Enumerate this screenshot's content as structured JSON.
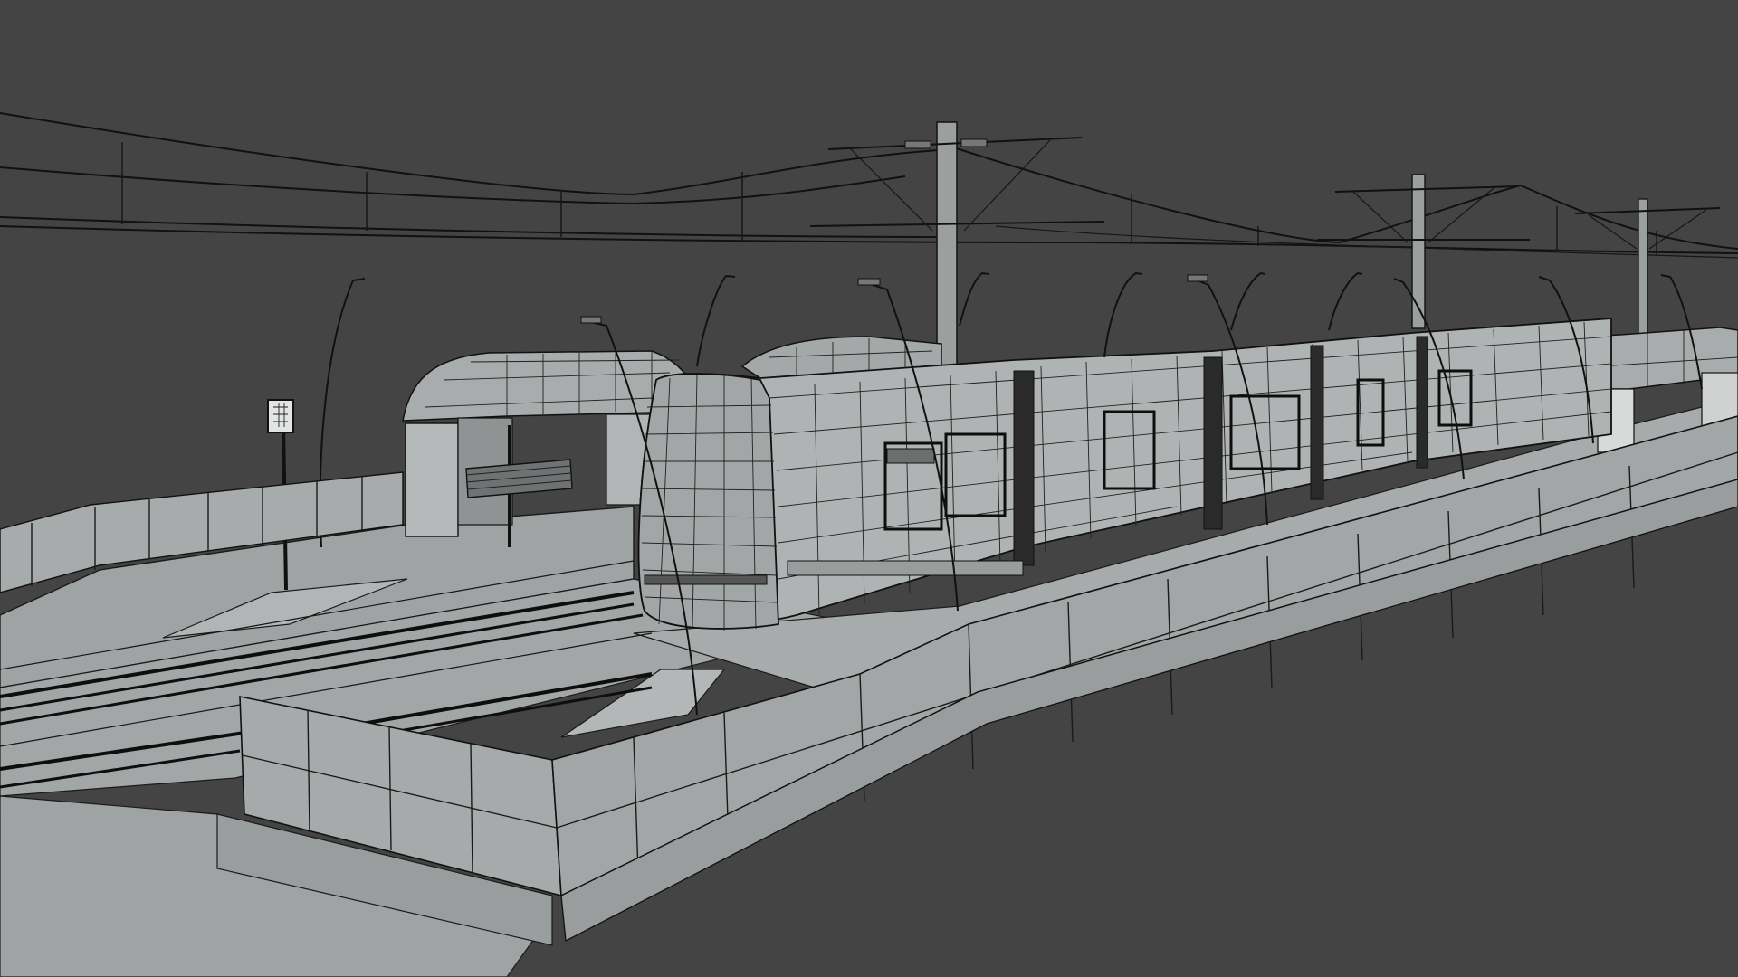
{
  "viewport": {
    "background_color": "#444444",
    "shading": "wireframe-on-shaded",
    "surface_color": "#a7aaaa",
    "wire_color": "#111111"
  },
  "scene_objects": [
    "overhead-catenary-wires",
    "catenary-poles",
    "street-lamps",
    "tram-shelter-left",
    "tram-shelter-right",
    "tram",
    "platform-left",
    "platform-right",
    "barrier-wall",
    "rails",
    "bus-stop-sign"
  ]
}
